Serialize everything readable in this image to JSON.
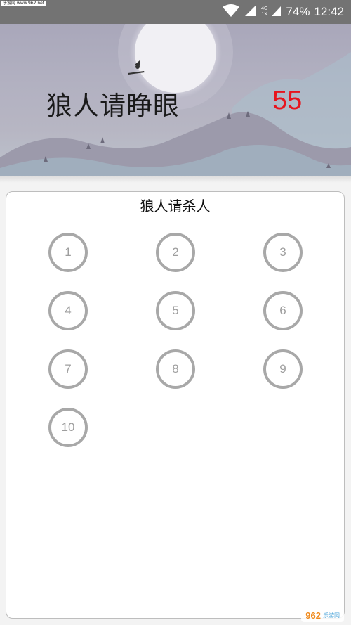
{
  "status_bar": {
    "watermark": "乐游网 www.962.net",
    "network_top": "4G",
    "network_bottom": "1X",
    "battery": "74%",
    "time": "12:42",
    "icons": [
      "wifi-icon",
      "signal-icon",
      "signal-icon-2"
    ]
  },
  "header": {
    "phase_title": "狼人请睁眼",
    "countdown": "55",
    "countdown_color": "#e8141c"
  },
  "card": {
    "title": "狼人请杀人",
    "players": [
      "1",
      "2",
      "3",
      "4",
      "5",
      "6",
      "7",
      "8",
      "9",
      "10"
    ]
  },
  "watermark_bottom": {
    "brand": "962",
    "sub": "乐游网"
  }
}
